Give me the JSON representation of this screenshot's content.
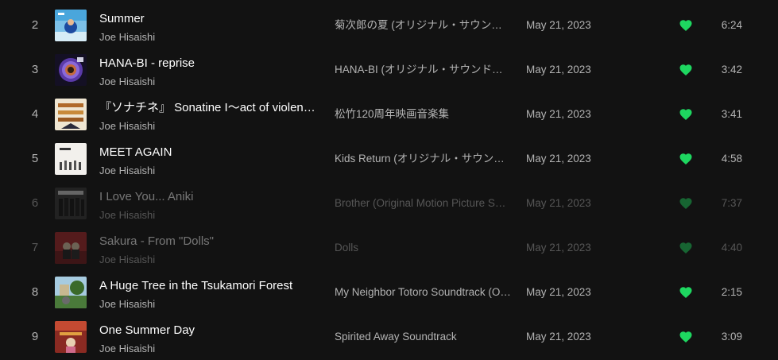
{
  "tracks": [
    {
      "num": "2",
      "title": "Summer",
      "artist": "Joe Hisaishi",
      "album": "菊次郎の夏 (オリジナル・サウンドトラック)",
      "date": "May 21, 2023",
      "duration": "6:24",
      "dim": false,
      "cover_icon": "summer-cover-icon"
    },
    {
      "num": "3",
      "title": "HANA-BI - reprise",
      "artist": "Joe Hisaishi",
      "album": "HANA-BI (オリジナル・サウンドトラック)",
      "date": "May 21, 2023",
      "duration": "3:42",
      "dim": false,
      "cover_icon": "hanabi-cover-icon"
    },
    {
      "num": "4",
      "title": "『ソナチネ』 Sonatine I〜act of violence〜",
      "artist": "Joe Hisaishi",
      "album": "松竹120周年映画音楽集",
      "date": "May 21, 2023",
      "duration": "3:41",
      "dim": false,
      "cover_icon": "shochiku-cover-icon"
    },
    {
      "num": "5",
      "title": "MEET AGAIN",
      "artist": "Joe Hisaishi",
      "album": "Kids Return (オリジナル・サウンドトラック)",
      "date": "May 21, 2023",
      "duration": "4:58",
      "dim": false,
      "cover_icon": "kids-return-cover-icon"
    },
    {
      "num": "6",
      "title": "I Love You... Aniki",
      "artist": "Joe Hisaishi",
      "album": "Brother (Original Motion Picture Soundtrack)",
      "date": "May 21, 2023",
      "duration": "7:37",
      "dim": true,
      "cover_icon": "brother-cover-icon"
    },
    {
      "num": "7",
      "title": "Sakura - From \"Dolls\"",
      "artist": "Joe Hisaishi",
      "album": "Dolls",
      "date": "May 21, 2023",
      "duration": "4:40",
      "dim": true,
      "cover_icon": "dolls-cover-icon"
    },
    {
      "num": "8",
      "title": "A Huge Tree in the Tsukamori Forest",
      "artist": "Joe Hisaishi",
      "album": "My Neighbor Totoro Soundtrack (Original)",
      "date": "May 21, 2023",
      "duration": "2:15",
      "dim": false,
      "cover_icon": "totoro-cover-icon"
    },
    {
      "num": "9",
      "title": "One Summer Day",
      "artist": "Joe Hisaishi",
      "album": "Spirited Away Soundtrack",
      "date": "May 21, 2023",
      "duration": "3:09",
      "dim": false,
      "cover_icon": "spirited-away-cover-icon"
    }
  ],
  "colors": {
    "background": "#121212",
    "primary_text": "#ffffff",
    "secondary_text": "#b3b3b3",
    "liked_heart": "#1ed760"
  },
  "icons": {
    "liked": "heart-filled-icon"
  }
}
